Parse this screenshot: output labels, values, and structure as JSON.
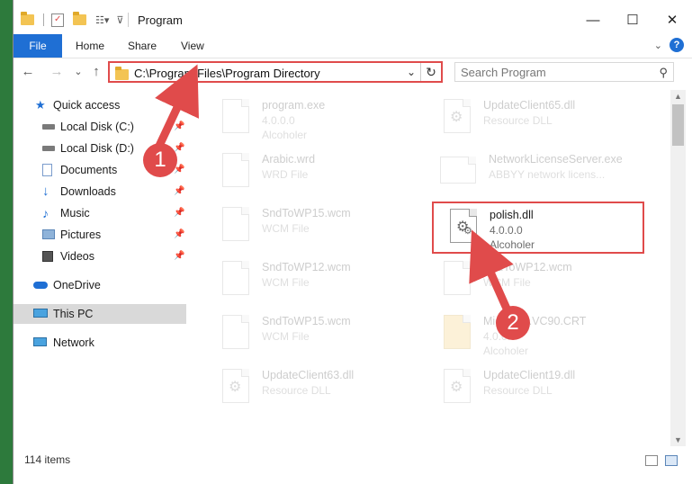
{
  "window": {
    "title": "Program",
    "minimize_icon": "minimize-icon",
    "maximize_icon": "maximize-icon",
    "close_icon": "close-icon"
  },
  "ribbon": {
    "file": "File",
    "home": "Home",
    "share": "Share",
    "view": "View"
  },
  "nav": {
    "back": "←",
    "forward": "→",
    "recent": "⌄",
    "up": "↑",
    "address": "C:\\Program Files\\Program Directory",
    "search_placeholder": "Search Program"
  },
  "sidebar": {
    "items": [
      {
        "label": "Quick access",
        "icon": "star-icon",
        "pinned": false
      },
      {
        "label": "Local Disk (C:)",
        "icon": "drive-icon",
        "pinned": true
      },
      {
        "label": "Local Disk (D:)",
        "icon": "drive-icon",
        "pinned": true
      },
      {
        "label": "Documents",
        "icon": "documents-icon",
        "pinned": true
      },
      {
        "label": "Downloads",
        "icon": "download-icon",
        "pinned": true
      },
      {
        "label": "Music",
        "icon": "music-icon",
        "pinned": true
      },
      {
        "label": "Pictures",
        "icon": "pictures-icon",
        "pinned": true
      },
      {
        "label": "Videos",
        "icon": "videos-icon",
        "pinned": true
      },
      {
        "label": "OneDrive",
        "icon": "cloud-icon",
        "pinned": false
      },
      {
        "label": "This PC",
        "icon": "computer-icon",
        "pinned": false,
        "selected": true
      },
      {
        "label": "Network",
        "icon": "network-icon",
        "pinned": false
      }
    ]
  },
  "files": [
    {
      "name": "program.exe",
      "line1": "4.0.0.0",
      "line2": "Alcoholer",
      "icon": "exe-icon"
    },
    {
      "name": "UpdateClient65.dll",
      "line1": "Resource DLL",
      "line2": "",
      "icon": "dll-icon"
    },
    {
      "name": "Arabic.wrd",
      "line1": "WRD File",
      "line2": "",
      "icon": "file-icon"
    },
    {
      "name": "NetworkLicenseServer.exe",
      "line1": "ABBYY network licens...",
      "line2": "",
      "icon": "exe-icon"
    },
    {
      "name": "SndToWP15.wcm",
      "line1": "WCM File",
      "line2": "",
      "icon": "file-icon"
    },
    {
      "name": "polish.dll",
      "line1": "4.0.0.0",
      "line2": "Alcoholer",
      "icon": "dll-icon",
      "highlighted": true
    },
    {
      "name": "SndToWP12.wcm",
      "line1": "WCM File",
      "line2": "",
      "icon": "file-icon"
    },
    {
      "name": "SndToWP12.wcm",
      "line1": "WCM File",
      "line2": "",
      "icon": "file-icon"
    },
    {
      "name": "SndToWP15.wcm",
      "line1": "WCM File",
      "line2": "",
      "icon": "file-icon"
    },
    {
      "name": "Microsoft.VC90.CRT",
      "line1": "4.0.0.0",
      "line2": "Alcoholer",
      "icon": "folder-icon"
    },
    {
      "name": "UpdateClient63.dll",
      "line1": "Resource DLL",
      "line2": "",
      "icon": "dll-icon"
    },
    {
      "name": "UpdateClient19.dll",
      "line1": "Resource DLL",
      "line2": "",
      "icon": "dll-icon"
    }
  ],
  "status": {
    "count": "114 items"
  },
  "annotations": {
    "step1": "1",
    "step2": "2",
    "color": "#e04b4b"
  }
}
